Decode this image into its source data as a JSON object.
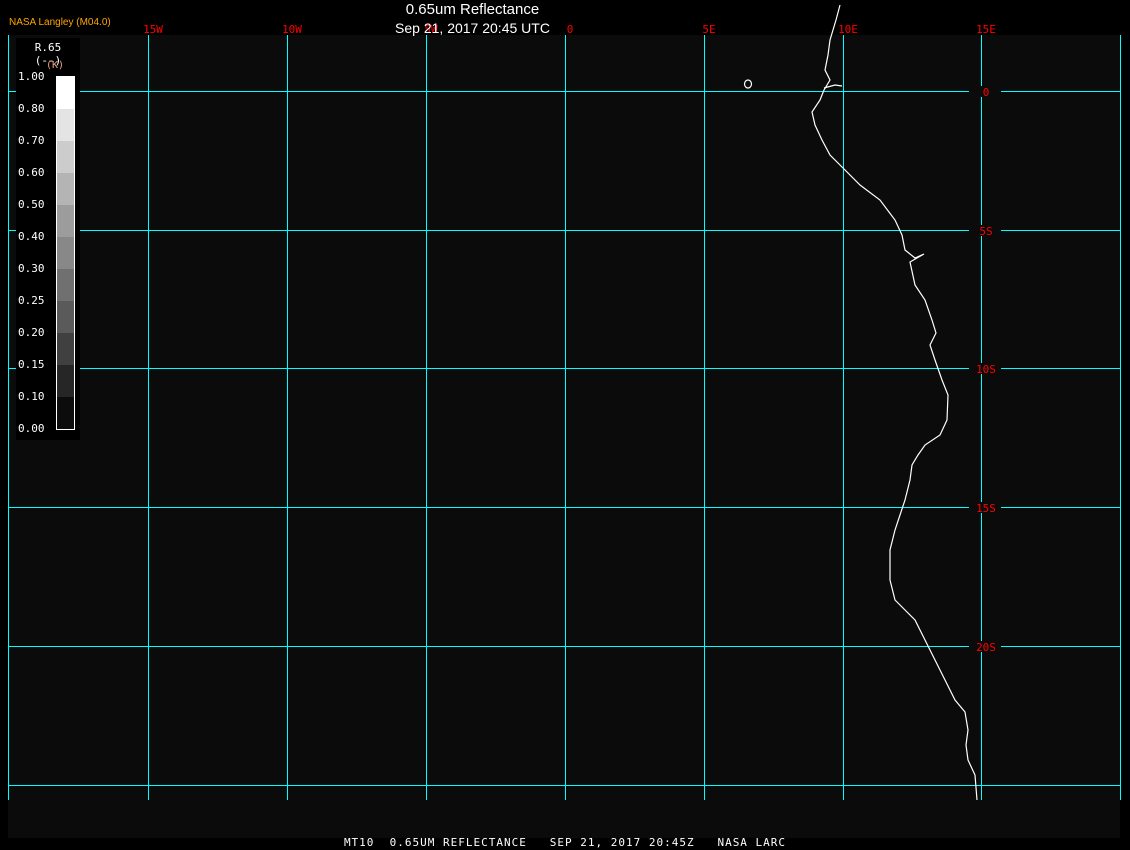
{
  "header": {
    "title": "0.65um Reflectance",
    "datetime": "Sep 21, 2017 20:45 UTC",
    "producer": "NASA Langley (M04.0)"
  },
  "footer": {
    "text": "MT10  0.65UM REFLECTANCE   SEP 21, 2017 20:45Z   NASA LARC"
  },
  "legend": {
    "variable": "R.65",
    "units": "(--)",
    "units_alt": "(K)",
    "ticks": [
      "1.00",
      "0.80",
      "0.70",
      "0.60",
      "0.50",
      "0.40",
      "0.30",
      "0.25",
      "0.20",
      "0.15",
      "0.10",
      "0.00"
    ],
    "colors": [
      "#ffffff",
      "#e4e4e4",
      "#cccccc",
      "#b4b4b4",
      "#9c9c9c",
      "#888888",
      "#707070",
      "#5a5a5a",
      "#404040",
      "#262626",
      "#0c0c0c"
    ]
  },
  "map": {
    "background": "#0b0b0b",
    "grid_color": "#00ffff",
    "label_color": "#ff0000",
    "coast_color": "#ffffff",
    "lon_labels": [
      "15W",
      "10W",
      "5W",
      "0",
      "5E",
      "10E",
      "15E"
    ],
    "lat_labels": [
      "0",
      "5S",
      "10S",
      "15S",
      "20S"
    ]
  }
}
